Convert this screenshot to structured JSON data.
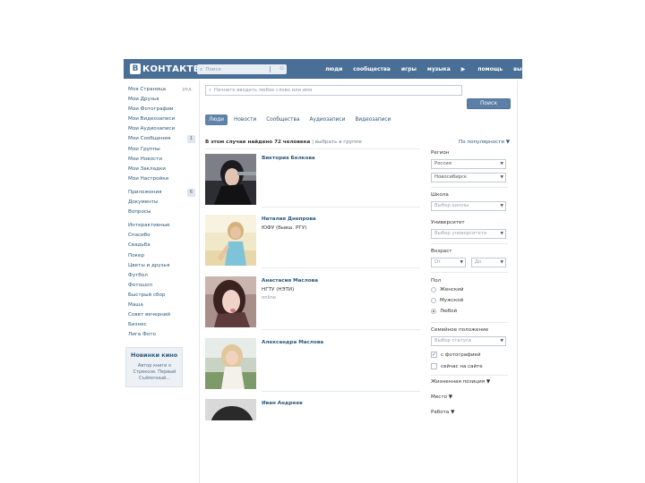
{
  "header": {
    "logo_mark": "В",
    "logo_text": "КОНТАКТЕ",
    "search_placeholder": "Поиск",
    "search_icon": "search-icon",
    "nav": [
      "люди",
      "сообщества",
      "игры",
      "музыка",
      "помощь",
      "выйти"
    ],
    "nav_arrow": "▶"
  },
  "sidebar": {
    "items": [
      {
        "label": "Моя Страница",
        "count": "ред."
      },
      {
        "label": "Мои Друзья",
        "count": ""
      },
      {
        "label": "Мои Фотографии",
        "count": ""
      },
      {
        "label": "Мои Видеозаписи",
        "count": ""
      },
      {
        "label": "Мои Аудиозаписи",
        "count": ""
      },
      {
        "label": "Мои Сообщения",
        "count": "1"
      },
      {
        "label": "Мои Группы",
        "count": ""
      },
      {
        "label": "Мои Новости",
        "count": ""
      },
      {
        "label": "Мои Закладки",
        "count": ""
      },
      {
        "label": "Мои Настройки",
        "count": ""
      }
    ],
    "apps": [
      {
        "label": "Приложения",
        "count": "6"
      },
      {
        "label": "Документы",
        "count": ""
      },
      {
        "label": "Вопросы",
        "count": ""
      }
    ],
    "extra": [
      "Интерактивные",
      "Спасибо",
      "Свадьба",
      "Покер",
      "Цветы и друзья",
      "Футбол",
      "Фотошоп",
      "Быстрый сбор",
      "Маша",
      "Совет вечерний",
      "Бизнес",
      "Лига Фото"
    ],
    "promo": {
      "title": "Новинки кино",
      "text": "Автор книги о Стрекозе. Первый Съёмочный..."
    }
  },
  "main": {
    "search_placeholder": "Начните вводить любое слово или имя",
    "search_button": "Поиск",
    "tabs": [
      "Люди",
      "Новости",
      "Сообщества",
      "Аудиозаписи",
      "Видеозаписи"
    ],
    "results_head_bold": "В этом случае найдено 72 человека",
    "results_head_muted": "| выбрать в группе",
    "sort_label": "По популярности ▼",
    "people": [
      {
        "name": "Виктория Белкова",
        "info1": "",
        "info2": ""
      },
      {
        "name": "Наталия Днепрова",
        "info1": "ЮФУ (бывш. РГУ)",
        "info2": ""
      },
      {
        "name": "Анастасия Маслова",
        "info1": "НГТУ (НЭТИ)",
        "info2": "online"
      },
      {
        "name": "Александра Маслова",
        "info1": "",
        "info2": ""
      },
      {
        "name": "Иван Андреев",
        "info1": "",
        "info2": ""
      }
    ]
  },
  "filters": {
    "region_label": "Регион",
    "country_value": "Россия",
    "city_value": "Новосибирск",
    "school_label": "Школа",
    "school_placeholder": "Выбор школы",
    "university_label": "Университет",
    "university_placeholder": "Выбор университета",
    "age_label": "Возраст",
    "age_from": "От",
    "age_to": "До",
    "gender_label": "Пол",
    "gender_options": [
      "Женский",
      "Мужской",
      "Любой"
    ],
    "gender_selected": 2,
    "marital_label": "Семейное положение",
    "marital_placeholder": "Выбор статуса",
    "with_photo_label": "с фотографией",
    "online_label": "сейчас на сайте",
    "more_links": [
      "Жизненная позиция ▼",
      "Место ▼",
      "Работа ▼"
    ]
  }
}
